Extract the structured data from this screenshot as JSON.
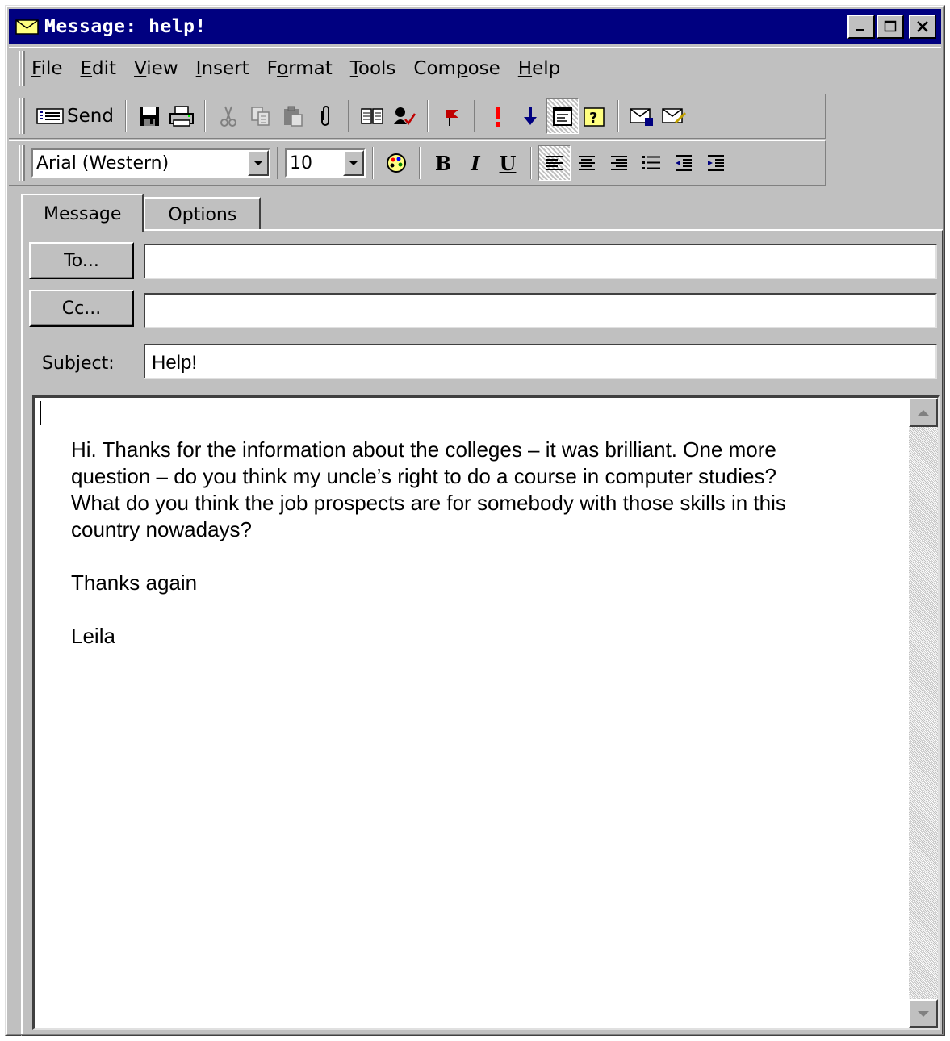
{
  "window": {
    "title": "Message:  help!"
  },
  "menu": [
    "File",
    "Edit",
    "View",
    "Insert",
    "Format",
    "Tools",
    "Compose",
    "Help"
  ],
  "menu_underline_index": [
    0,
    0,
    0,
    0,
    1,
    0,
    3,
    0
  ],
  "toolbar": {
    "send_label": "Send"
  },
  "format_bar": {
    "font": "Arial (Western)",
    "size": "10",
    "bold": "B",
    "italic": "I",
    "underline": "U"
  },
  "tabs": [
    "Message",
    "Options"
  ],
  "fields": {
    "to_button": "To...",
    "cc_button": "Cc...",
    "to_value": "",
    "cc_value": "",
    "subject_label": "Subject:",
    "subject_value": "Help!"
  },
  "body": {
    "paragraphs": [
      "Hi. Thanks for the information about the colleges – it was brilliant. One more\nquestion – do you think my uncle’s right to do a course in computer studies?\nWhat do you think the job prospects are for somebody with those skills in this\ncountry nowadays?",
      "Thanks again",
      "Leila"
    ]
  }
}
